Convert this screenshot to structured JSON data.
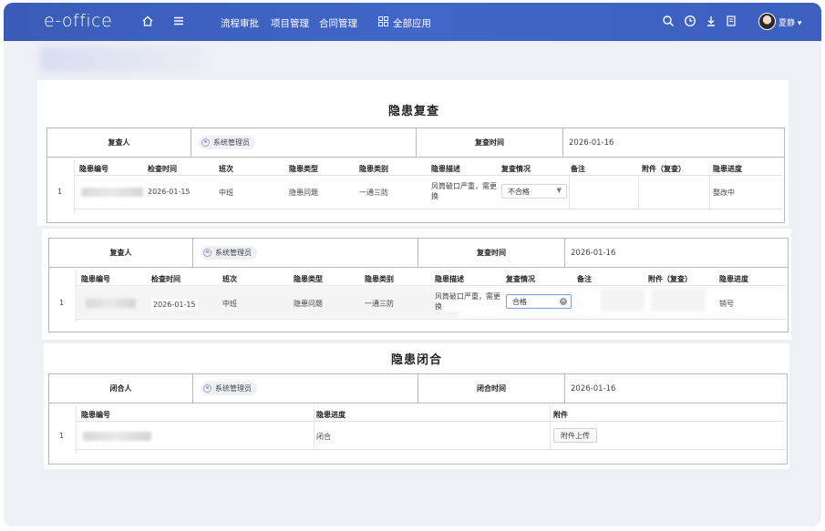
{
  "app": {
    "logo": "e-office",
    "nav": {
      "workflow": "流程审批",
      "projects": "项目管理",
      "contracts": "合同管理",
      "all_apps": "全部应用"
    },
    "user": {
      "name": "夏静"
    }
  },
  "sections": {
    "recheck_title": "隐患复查",
    "close_title": "隐患闭合"
  },
  "recheck_1": {
    "reviewer_label": "复查人",
    "reviewer": "系统管理员",
    "time_label": "复查时间",
    "time": "2026-01-16",
    "columns": [
      "隐患编号",
      "检查时间",
      "班次",
      "隐患类型",
      "隐患类别",
      "隐患描述",
      "复查情况",
      "备注",
      "附件（复查）",
      "隐患进度"
    ],
    "rows": [
      {
        "index": "1",
        "check_time": "2026-01-15",
        "shift": "中班",
        "type": "隐患问题",
        "category": "一通三防",
        "description": "风筒破口严重，需更换",
        "status": "不合格",
        "remark": "",
        "attachment": "",
        "progress": "整改中"
      }
    ]
  },
  "recheck_2": {
    "reviewer_label": "复查人",
    "reviewer": "系统管理员",
    "time_label": "复查时间",
    "time": "2026-01-16",
    "columns": [
      "隐患编号",
      "检查时间",
      "班次",
      "隐患类型",
      "隐患类别",
      "隐患描述",
      "复查情况",
      "备注",
      "附件（复查）",
      "隐患进度"
    ],
    "rows": [
      {
        "index": "1",
        "check_time": "2026-01-15",
        "shift": "中班",
        "type": "隐患问题",
        "category": "一通三防",
        "description": "风筒破口严重，需更换",
        "status": "合格",
        "remark": "",
        "attachment": "",
        "progress": "销号"
      }
    ]
  },
  "close": {
    "closer_label": "闭合人",
    "closer": "系统管理员",
    "time_label": "闭合时间",
    "time": "2026-01-16",
    "columns": [
      "隐患编号",
      "隐患进度",
      "附件"
    ],
    "rows": [
      {
        "index": "1",
        "progress": "闭合",
        "upload_label": "附件上传"
      }
    ]
  },
  "icons": {
    "home": "home-icon",
    "menu": "menu-icon",
    "apps": "grid-icon",
    "search": "search-icon",
    "clock": "clock-icon",
    "download": "download-icon",
    "doc": "document-icon"
  }
}
